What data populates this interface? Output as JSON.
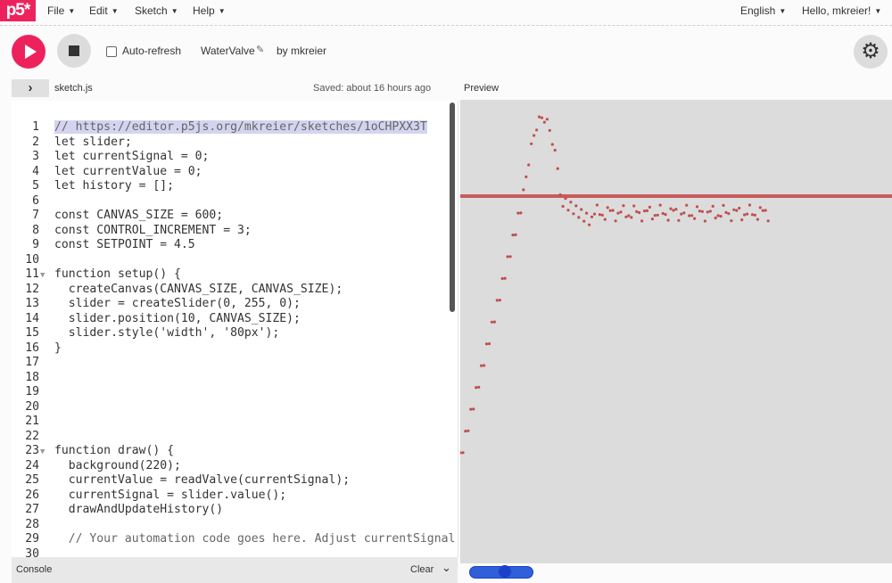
{
  "app": {
    "logo": "p5*"
  },
  "menu": {
    "items": [
      {
        "label": "File"
      },
      {
        "label": "Edit"
      },
      {
        "label": "Sketch"
      },
      {
        "label": "Help"
      }
    ],
    "language": "English",
    "greeting": "Hello, mkreier!"
  },
  "toolbar": {
    "auto_refresh_label": "Auto-refresh",
    "sketch_name": "WaterValve",
    "author": "by mkreier"
  },
  "editor": {
    "tab": "sketch.js",
    "saved": "Saved: about 16 hours ago",
    "lines": [
      {
        "n": "1",
        "fold": "",
        "text": "// https://editor.p5js.org/mkreier/sketches/1oCHPXX3T",
        "selected": true,
        "kind": "comment"
      },
      {
        "n": "2",
        "fold": "",
        "text": "let slider;"
      },
      {
        "n": "3",
        "fold": "",
        "text": "let currentSignal = 0;"
      },
      {
        "n": "4",
        "fold": "",
        "text": "let currentValue = 0;"
      },
      {
        "n": "5",
        "fold": "",
        "text": "let history = [];"
      },
      {
        "n": "6",
        "fold": "",
        "text": ""
      },
      {
        "n": "7",
        "fold": "",
        "text": "const CANVAS_SIZE = 600;"
      },
      {
        "n": "8",
        "fold": "",
        "text": "const CONTROL_INCREMENT = 3;"
      },
      {
        "n": "9",
        "fold": "",
        "text": "const SETPOINT = 4.5"
      },
      {
        "n": "10",
        "fold": "",
        "text": ""
      },
      {
        "n": "11",
        "fold": "▼",
        "text": "function setup() {"
      },
      {
        "n": "12",
        "fold": "",
        "text": "  createCanvas(CANVAS_SIZE, CANVAS_SIZE);"
      },
      {
        "n": "13",
        "fold": "",
        "text": "  slider = createSlider(0, 255, 0);"
      },
      {
        "n": "14",
        "fold": "",
        "text": "  slider.position(10, CANVAS_SIZE);"
      },
      {
        "n": "15",
        "fold": "",
        "text": "  slider.style('width', '80px');"
      },
      {
        "n": "16",
        "fold": "",
        "text": "}"
      },
      {
        "n": "17",
        "fold": "",
        "text": ""
      },
      {
        "n": "18",
        "fold": "",
        "text": ""
      },
      {
        "n": "19",
        "fold": "",
        "text": ""
      },
      {
        "n": "20",
        "fold": "",
        "text": ""
      },
      {
        "n": "21",
        "fold": "",
        "text": ""
      },
      {
        "n": "22",
        "fold": "",
        "text": ""
      },
      {
        "n": "23",
        "fold": "▼",
        "text": "function draw() {"
      },
      {
        "n": "24",
        "fold": "",
        "text": "  background(220);"
      },
      {
        "n": "25",
        "fold": "",
        "text": "  currentValue = readValve(currentSignal);"
      },
      {
        "n": "26",
        "fold": "",
        "text": "  currentSignal = slider.value();"
      },
      {
        "n": "27",
        "fold": "",
        "text": "  drawAndUpdateHistory()"
      },
      {
        "n": "28",
        "fold": "",
        "text": ""
      },
      {
        "n": "29",
        "fold": "",
        "text": "  // Your automation code goes here. Adjust currentSignal",
        "kind": "comment"
      },
      {
        "n": "30",
        "fold": "",
        "text": ""
      }
    ]
  },
  "preview": {
    "label": "Preview"
  },
  "console": {
    "label": "Console",
    "clear": "Clear"
  },
  "slider": {
    "value_fraction": 0.55
  },
  "colors": {
    "accent": "#ed225d",
    "plot_line": "#c85a5a",
    "plot_dot": "#c0504d",
    "canvas_bg": "#dcdcdc",
    "slider": "#1e40c8"
  },
  "icons": {
    "play": "play-icon",
    "stop": "stop-icon",
    "settings": "gear-icon",
    "pencil": "pencil-icon",
    "sidebar": "chevron-right-icon",
    "console_toggle": "chevron-down-icon"
  }
}
